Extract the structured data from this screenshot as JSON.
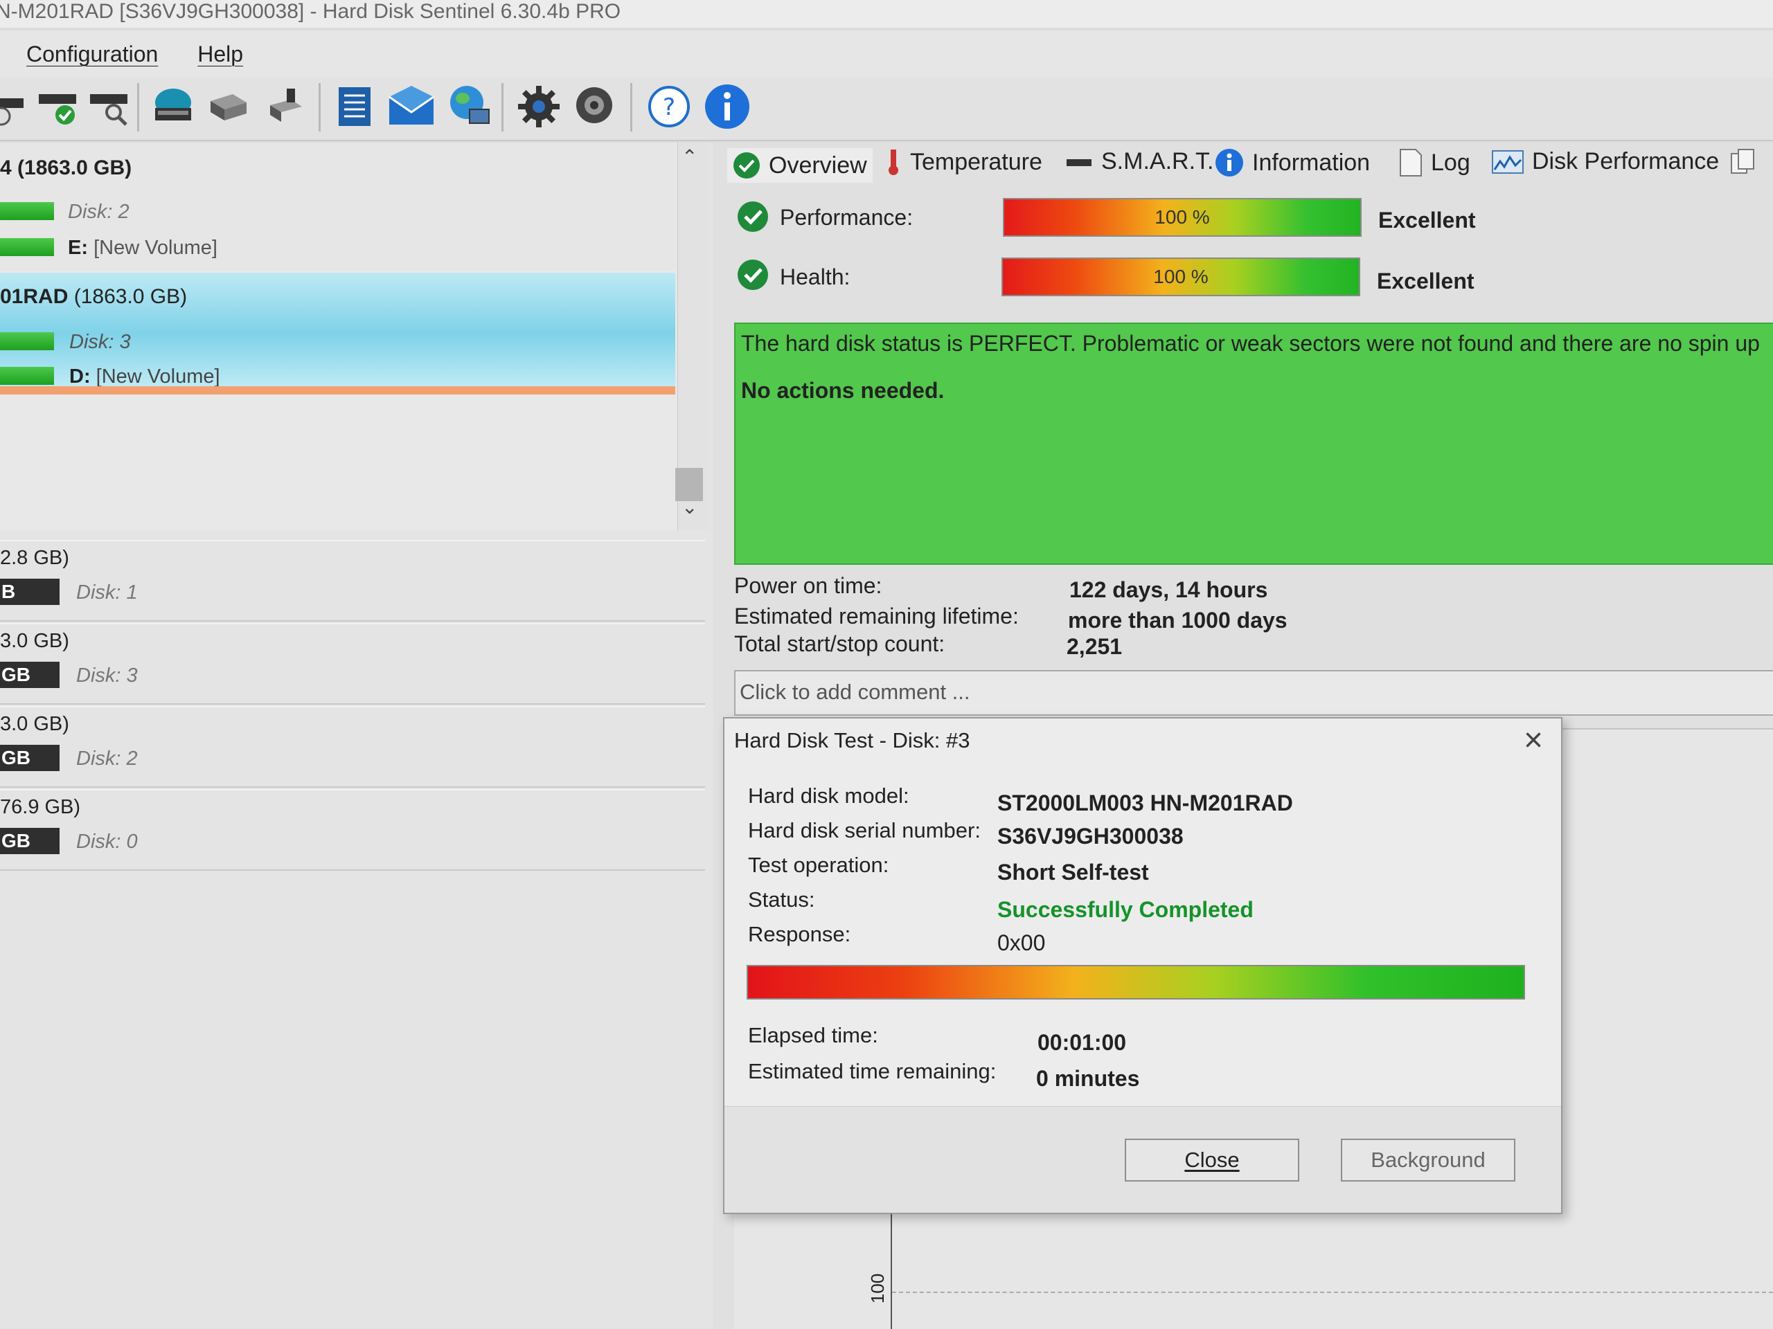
{
  "window": {
    "title": "N-M201RAD [S36VJ9GH300038]  -  Hard Disk Sentinel 6.30.4b PRO"
  },
  "menu": {
    "items": [
      "Configuration",
      "Help"
    ]
  },
  "toolbar": {
    "icons": [
      "clock-disk-icon",
      "disk-check-icon",
      "disk-search-icon",
      "disk-globe-icon",
      "disk-stack-icon",
      "disk-arrow-icon",
      "report-icon",
      "email-icon",
      "network-icon",
      "gear-icon",
      "speaker-icon",
      "help-icon",
      "info-icon"
    ]
  },
  "disks": {
    "group1": {
      "header": "4 (1863.0 GB)",
      "disk": "Disk: 2",
      "volume_prefix": "E:",
      "volume": "[New Volume]"
    },
    "group2": {
      "header_bold": "01RAD",
      "header_size": "(1863.0 GB)",
      "disk": "Disk: 3",
      "volume_prefix": "D:",
      "volume": "[New Volume]"
    }
  },
  "volumes": [
    {
      "header": "2.8 GB)",
      "bar": "B",
      "disk": "Disk: 1"
    },
    {
      "header": "3.0 GB)",
      "bar": "GB",
      "disk": "Disk: 3"
    },
    {
      "header": "3.0 GB)",
      "bar": "GB",
      "disk": "Disk: 2"
    },
    {
      "header": "76.9 GB)",
      "bar": "GB",
      "disk": "Disk: 0"
    }
  ],
  "tabs": [
    "Overview",
    "Temperature",
    "S.M.A.R.T.",
    "Information",
    "Log",
    "Disk Performance"
  ],
  "overview": {
    "performance_label": "Performance:",
    "performance_value": "100 %",
    "performance_rating": "Excellent",
    "performance_fraction": 1.0,
    "health_label": "Health:",
    "health_value": "100 %",
    "health_rating": "Excellent",
    "health_fraction": 1.0,
    "status_text": "The hard disk status is PERFECT. Problematic or weak sectors were not found and there are no spin up",
    "action_text": "No actions needed.",
    "power_on_label": "Power on time:",
    "power_on_value": "122 days, 14 hours",
    "lifetime_label": "Estimated remaining lifetime:",
    "lifetime_value": "more than 1000 days",
    "startstop_label": "Total start/stop count:",
    "startstop_value": "2,251",
    "comment_placeholder": "Click to add comment ...",
    "chart_axis_tick": "100"
  },
  "dialog": {
    "title": "Hard Disk Test - Disk: #3",
    "model_label": "Hard disk model:",
    "model_value": "ST2000LM003 HN-M201RAD",
    "serial_label": "Hard disk serial number:",
    "serial_value": "S36VJ9GH300038",
    "operation_label": "Test operation:",
    "operation_value": "Short Self-test",
    "status_label": "Status:",
    "status_value": "Successfully Completed",
    "response_label": "Response:",
    "response_value": "0x00",
    "progress_fraction": 1.0,
    "elapsed_label": "Elapsed time:",
    "elapsed_value": "00:01:00",
    "remaining_label": "Estimated time remaining:",
    "remaining_value": "0 minutes",
    "close_button": "Close",
    "background_button": "Background"
  },
  "colors": {
    "status_green": "#52c84c",
    "success_text": "#15922a",
    "selection": "#7fd2e8"
  }
}
